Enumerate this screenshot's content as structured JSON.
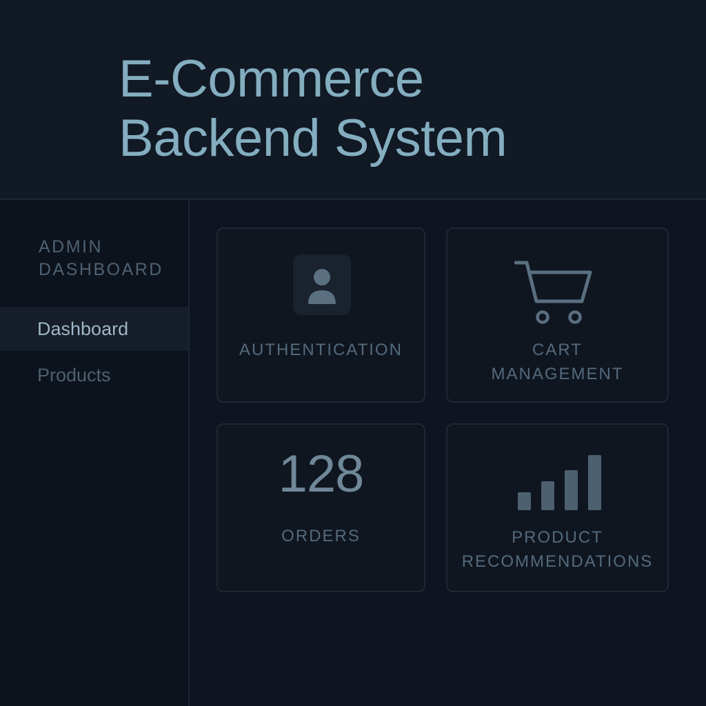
{
  "header": {
    "title_line1": "E-Commerce",
    "title_line2": "Backend System"
  },
  "sidebar": {
    "heading_line1": "ADMIN",
    "heading_line2": "DASHBOARD",
    "items": [
      {
        "label": "Dashboard",
        "active": true
      },
      {
        "label": "Products",
        "active": false
      }
    ]
  },
  "cards": {
    "authentication": {
      "label": "AUTHENTICATION",
      "icon": "user-icon"
    },
    "cart": {
      "label_line1": "CART",
      "label_line2": "MANAGEMENT",
      "icon": "shopping-cart-icon"
    },
    "orders": {
      "value": "128",
      "label": "ORDERS"
    },
    "recommendations": {
      "label_line1": "PRODUCT",
      "label_line2": "RECOMMENDATIONS",
      "icon": "bar-chart-icon"
    }
  },
  "colors": {
    "background": "#0e1520",
    "title": "#84aec0",
    "muted_text": "#546a7c",
    "card_border": "#1e2833"
  }
}
